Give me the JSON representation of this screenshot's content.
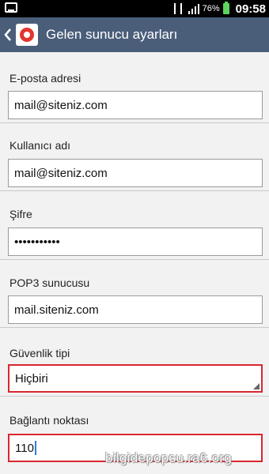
{
  "status_bar": {
    "battery": "76%",
    "time": "09:58",
    "battery_color": "#5fd35f"
  },
  "action_bar": {
    "title": "Gelen sunucu ayarları",
    "color": "#4a5e7a"
  },
  "fields": {
    "email": {
      "label": "E-posta adresi",
      "value": "mail@siteniz.com"
    },
    "username": {
      "label": "Kullanıcı adı",
      "value": "mail@siteniz.com"
    },
    "password": {
      "label": "Şifre",
      "value": "•••••••••••"
    },
    "pop3": {
      "label": "POP3 sunucusu",
      "value": "mail.siteniz.com"
    },
    "security": {
      "label": "Güvenlik tipi",
      "value": "Hiçbiri"
    },
    "port": {
      "label": "Bağlantı noktası",
      "value": "110"
    }
  },
  "highlight_color": "#d9262f",
  "watermark": "bilgidepopsu.ra6.org"
}
